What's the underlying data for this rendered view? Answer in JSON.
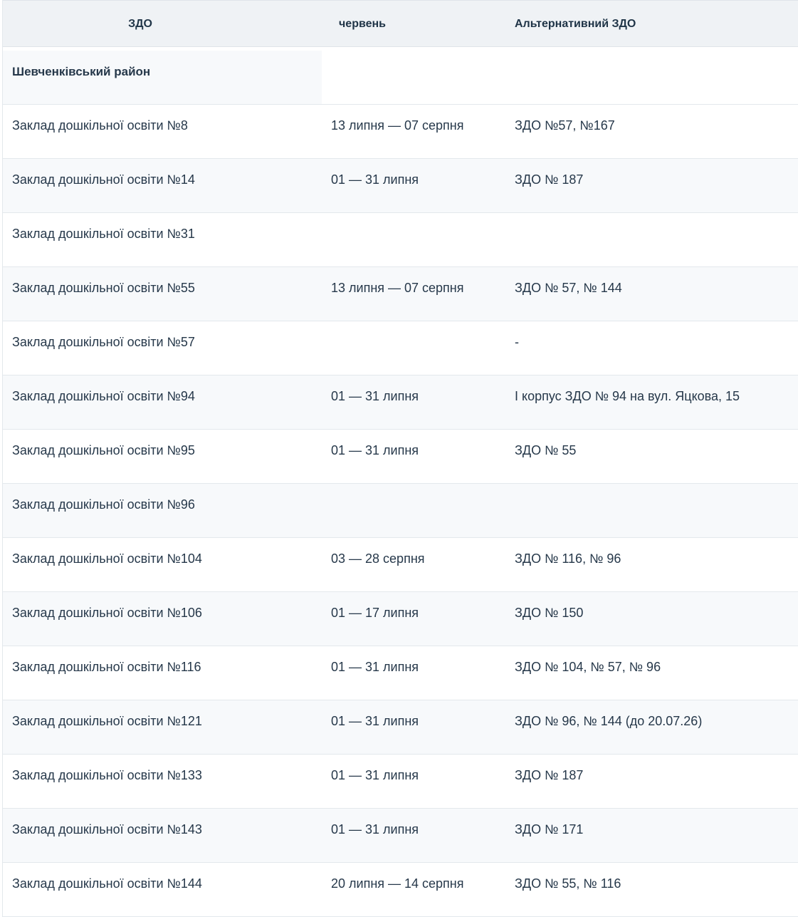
{
  "table": {
    "headers": [
      "ЗДО",
      "червень",
      "Альтернативний ЗДО"
    ],
    "district": "Шевченківський район",
    "rows": [
      [
        "Заклад дошкільної освіти №8",
        "13 липня — 07 серпня",
        "ЗДО №57, №167"
      ],
      [
        "Заклад дошкільної освіти №14",
        "01 — 31 липня",
        "ЗДО № 187"
      ],
      [
        "Заклад дошкільної освіти №31",
        "",
        ""
      ],
      [
        "Заклад дошкільної освіти №55",
        "13 липня — 07 серпня",
        "ЗДО № 57, № 144"
      ],
      [
        "Заклад дошкільної освіти №57",
        "",
        "-"
      ],
      [
        "Заклад дошкільної освіти №94",
        "01 — 31 липня",
        "І корпус ЗДО № 94 на вул. Яцкова, 15"
      ],
      [
        "Заклад дошкільної освіти №95",
        "01 — 31 липня",
        "ЗДО № 55"
      ],
      [
        "Заклад дошкільної освіти №96",
        "",
        ""
      ],
      [
        "Заклад дошкільної освіти №104",
        "03 — 28 серпня",
        "ЗДО № 116, № 96"
      ],
      [
        "Заклад дошкільної освіти №106",
        "01 — 17 липня",
        "ЗДО № 150"
      ],
      [
        "Заклад дошкільної освіти №116",
        "01 — 31 липня",
        "ЗДО № 104, № 57, № 96"
      ],
      [
        "Заклад дошкільної освіти №121",
        "01 — 31 липня",
        "ЗДО № 96, № 144  (до 20.07.26)"
      ],
      [
        "Заклад дошкільної освіти №133",
        "01 — 31 липня",
        "ЗДО № 187"
      ],
      [
        "Заклад дошкільної освіти №143",
        "01 — 31 липня",
        "ЗДО № 171"
      ],
      [
        "Заклад дошкільної освіти №144",
        "20 липня — 14 серпня",
        "ЗДО № 55, № 116"
      ]
    ]
  }
}
